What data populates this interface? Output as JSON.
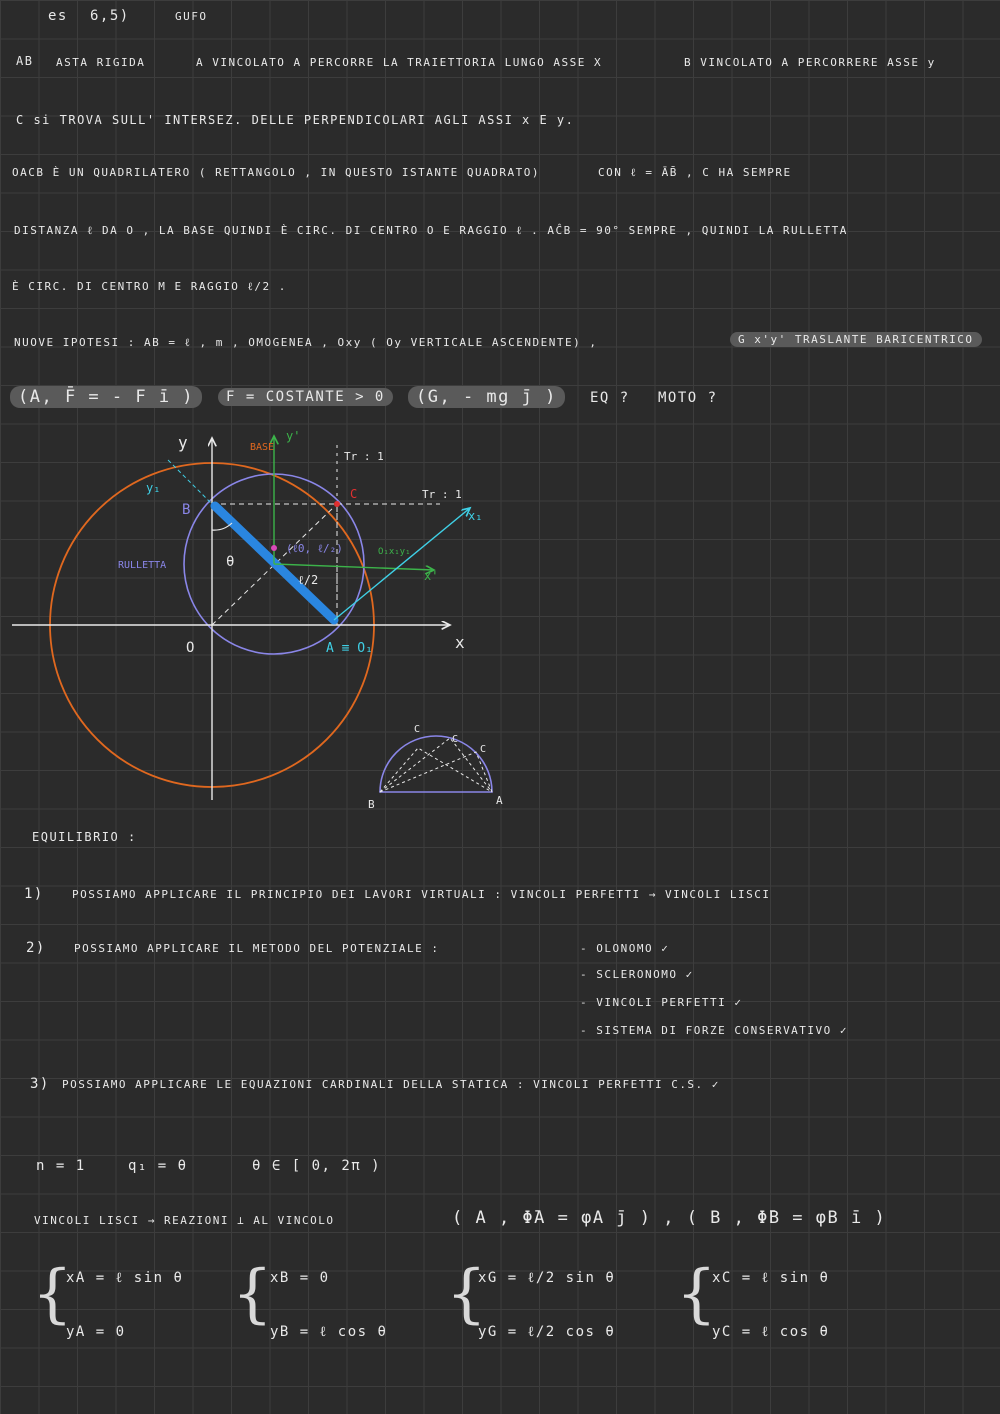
{
  "header": {
    "ex": "es",
    "num": "6,5)",
    "tag": "GUFO"
  },
  "text": {
    "l1a": "AB",
    "l1b": "ASTA RIGIDA",
    "l1c": "A VINCOLATO A PERCORRE LA TRAIETTORIA LUNGO ASSE X",
    "l1d": "B VINCOLATO A PERCORRERE ASSE y",
    "l2": "C si TROVA SULL' INTERSEZ. DELLE PERPENDICOLARI AGLI ASSI x E y.",
    "l3a": "OACB È UN QUADRILATERO ( RETTANGOLO , IN QUESTO ISTANTE QUADRATO)",
    "l3b": "CON ℓ = ĀB̄ , C HA SEMPRE",
    "l4": "DISTANZA ℓ DA O , LA BASE QUINDI È CIRC. DI CENTRO O E RAGGIO ℓ . AĈB = 90° SEMPRE , QUINDI LA RULLETTA",
    "l5": "È CIRC. DI CENTRO M E RAGGIO ℓ/2 .",
    "l6a": "NUOVE IPOTESI : AB = ℓ , m , OMOGENEA , Oxy ( Oy VERTICALE ASCENDENTE) ,",
    "l6b": "G x'y' TRASLANTE BARICENTRICO",
    "l7a": "(A, F̄ = - F ī )",
    "l7b": "F = COSTANTE > 0",
    "l7c": "(G, - mg j̄ )",
    "l7d": "EQ ?",
    "l7e": "MOTO ?"
  },
  "diagram": {
    "y_label": "y",
    "x_label": "x",
    "o_label": "O",
    "b_label": "B",
    "a_label": "A ≡ O₁",
    "theta": "θ",
    "rulletta": "RULLETTA",
    "base": "BASE",
    "yprime": "y'",
    "xprime": "x'",
    "y1": "y₁",
    "x1": "x₁",
    "c_label": "C",
    "m_label": "(ℓ0, ℓ/₂)",
    "o1x": "O₁x₁y₁",
    "half": "ℓ/2",
    "tr1": "Tr : 1",
    "tr2": "Tr : 1",
    "mini_b": "B",
    "mini_a": "A",
    "mini_c1": "C",
    "mini_c2": "C",
    "mini_c3": "C"
  },
  "equilibrium": {
    "title": "EQUILIBRIO :",
    "i1n": "1)",
    "i1": "POSSIAMO APPLICARE IL PRINCIPIO DEI LAVORI VIRTUALI : VINCOLI PERFETTI → VINCOLI LISCI",
    "i2n": "2)",
    "i2": "POSSIAMO APPLICARE IL METODO DEL POTENZIALE :",
    "c1": "- OLONOMO ✓",
    "c2": "- SCLERONOMO ✓",
    "c3": "- VINCOLI PERFETTI ✓",
    "c4": "- SISTEMA DI FORZE CONSERVATIVO ✓",
    "i3n": "3)",
    "i3": "POSSIAMO APPLICARE LE EQUAZIONI CARDINALI DELLA STATICA : VINCOLI PERFETTI C.S. ✓"
  },
  "bottom": {
    "n": "n = 1",
    "q": "q₁ = θ",
    "range": "θ ∈ [ 0, 2π )",
    "v1": "VINCOLI LISCI → REAZIONI ⊥ AL VINCOLO",
    "v2": "( A , Φ̄A = φA j̄ ) , ( B , Φ̄B = φB ī )",
    "xa": "xA = ℓ sin θ",
    "ya": "yA = 0",
    "xb": "xB = 0",
    "yb": "yB = ℓ cos θ",
    "xg": "xG = ℓ/2 sin θ",
    "yg": "yG = ℓ/2 cos θ",
    "xc": "xC = ℓ sin θ",
    "yc": "yC = ℓ cos θ"
  },
  "colors": {
    "orange": "#e0681f",
    "purple": "#8a86e8",
    "blue": "#2a86e0",
    "cyan": "#3fd0e6",
    "green": "#3cb34a",
    "red": "#e03030"
  }
}
